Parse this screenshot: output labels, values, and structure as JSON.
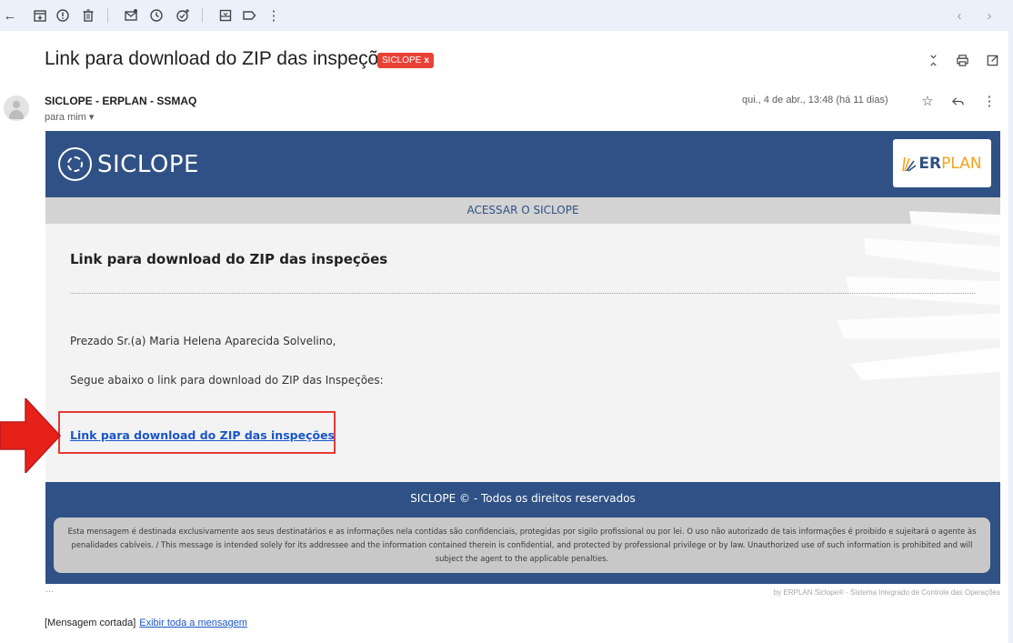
{
  "toolbar": {
    "icons": [
      "back-arrow-icon",
      "archive-icon",
      "report-spam-icon",
      "delete-icon",
      "mark-unread-icon",
      "snooze-icon",
      "add-task-icon",
      "move-to-icon",
      "labels-icon",
      "more-vert-icon"
    ],
    "nav": [
      "previous-icon",
      "next-icon"
    ]
  },
  "message": {
    "subject": "Link para download do ZIP das inspeções",
    "label": "SICLOPE",
    "label_remove": "x",
    "sender": "SICLOPE - ERPLAN - SSMAQ",
    "to": "para mim",
    "date": "qui., 4 de abr., 13:48 (há 11 dias)",
    "ellipsis": "...",
    "clipped_notice": "[Mensagem cortada]",
    "show_full": "Exibir toda a mensagem"
  },
  "email": {
    "brand": "SICLOPE",
    "partner_brand_a": "ER",
    "partner_brand_b": "PLAN",
    "nav_link": "ACESSAR O SICLOPE",
    "title": "Link para download do ZIP das inspeções",
    "greeting": "Prezado Sr.(a) Maria Helena Aparecida Solvelino,",
    "instruction": "Segue abaixo o link para download do ZIP das Inspeções:",
    "download_link": "Link para download do ZIP das inspeções",
    "footer_title": "SICLOPE © - Todos os direitos reservados",
    "disclaimer": "Esta mensagem é destinada exclusivamente aos seus destinatários e as informações nela contidas são confidenciais, protegidas por sigilo profissional ou por lei. O uso não autorizado de tais informações é proibido e sujeitará o agente às penalidades cabíveis. / This message is intended solely for its addressee and the information contained therein is confidential, and protected by professional privilege or by law. Unauthorized use of such information is prohibited and will subject the agent to the applicable penalties.",
    "byline": "by ERPLAN Siclope® - Sistema Integrado de Controle das Operações"
  },
  "colors": {
    "toolbar_bg": "#eaf1fb",
    "brand_blue": "#2f5185",
    "label_red": "#e94235",
    "highlight_red": "#e53935",
    "link_blue": "#1a56c8"
  }
}
